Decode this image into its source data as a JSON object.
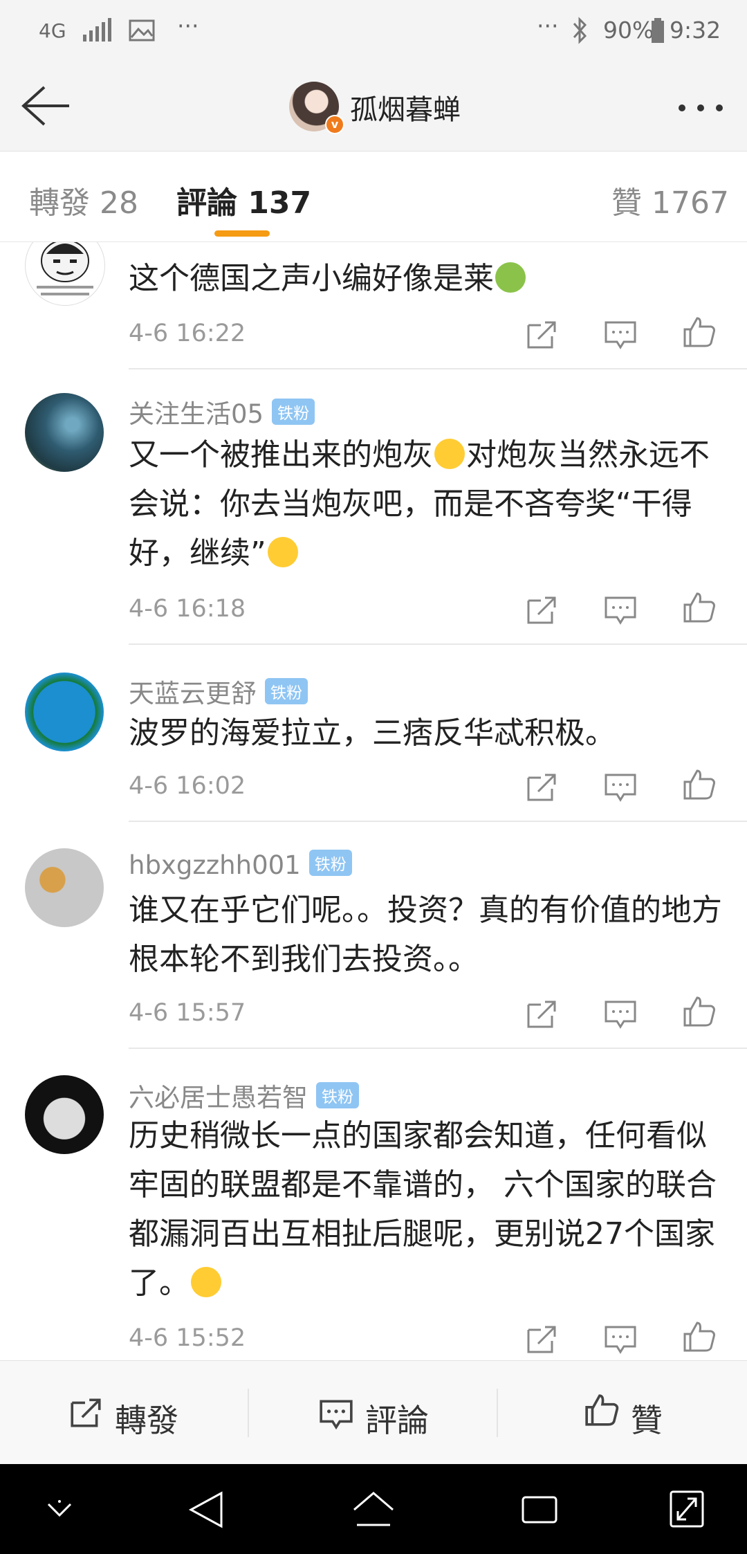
{
  "status_bar": {
    "network": "4G",
    "dots_left": "···",
    "dots_right": "···",
    "battery": "90%",
    "time": "9:32"
  },
  "header": {
    "title": "孤烟暮蝉"
  },
  "tabs": [
    {
      "label": "轉發 28"
    },
    {
      "label": "評論 137"
    },
    {
      "label": "贊 1767"
    }
  ],
  "comments": [
    {
      "user": "",
      "badge": "",
      "text": "这个德国之声小编好像是莱",
      "time": "4-6 16:22"
    },
    {
      "user": "关注生活05",
      "badge": "铁粉",
      "text_a": "又一个被推出来的炮灰",
      "text_b": "对炮灰当然永远不会说：你去当炮灰吧，而是不吝夸奖“干得好，继续”",
      "time": "4-6 16:18"
    },
    {
      "user": "天蓝云更舒",
      "badge": "铁粉",
      "text": "波罗的海爱拉立，三痞反华忒积极。",
      "time": "4-6 16:02"
    },
    {
      "user": "hbxgzzhh001",
      "badge": "铁粉",
      "text": "谁又在乎它们呢。。投资？真的有价值的地方根本轮不到我们去投资。。",
      "time": "4-6 15:57"
    },
    {
      "user": "六必居士愚若智",
      "badge": "铁粉",
      "text": "历史稍微长一点的国家都会知道，任何看似牢固的联盟都是不靠谱的， 六个国家的联合都漏洞百出互相扯后腿呢，更别说27个国家了。",
      "time": "4-6 15:52"
    }
  ],
  "bottom_bar": {
    "repost": "轉發",
    "comment": "評論",
    "like": "贊"
  }
}
